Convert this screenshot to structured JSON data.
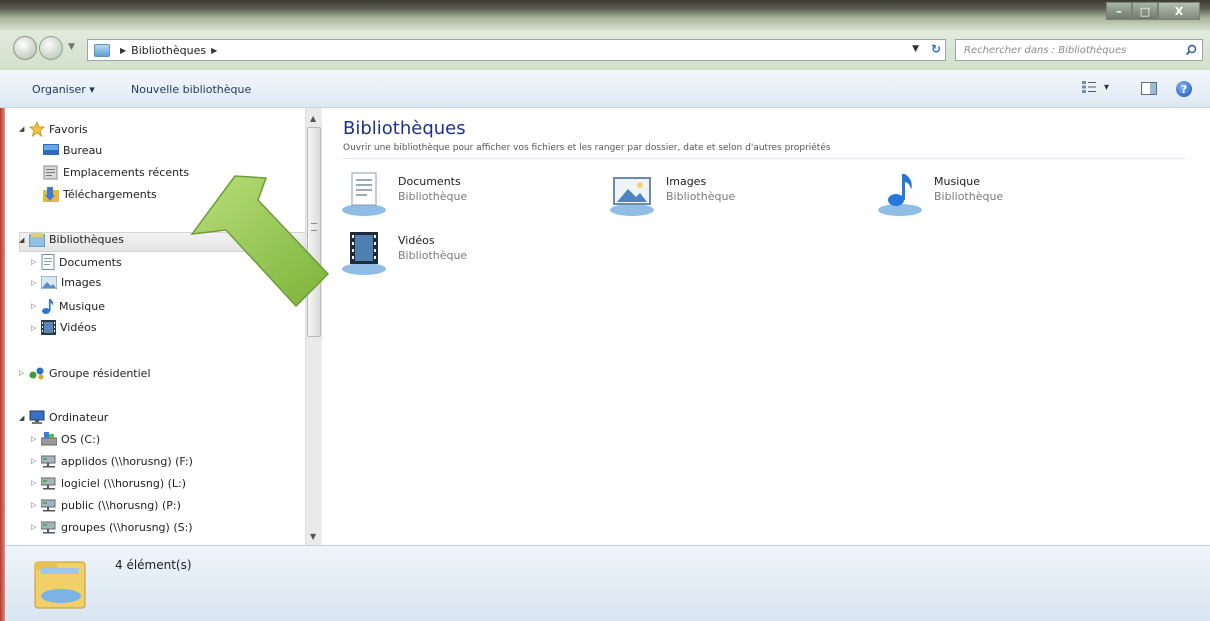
{
  "window": {
    "controls": {
      "minimize": "–",
      "maximize": "□",
      "close": "X"
    }
  },
  "address": {
    "crumbs": [
      "Bibliothèques"
    ],
    "search_placeholder": "Rechercher dans : Bibliothèques"
  },
  "toolbar": {
    "organize_label": "Organiser ▾",
    "new_library_label": "Nouvelle bibliothèque",
    "view_arrow": "▾",
    "help_label": "?"
  },
  "nav": {
    "favorites": {
      "label": "Favoris",
      "items": [
        {
          "label": "Bureau",
          "icon": "desktop-icon"
        },
        {
          "label": "Emplacements récents",
          "icon": "recent-places-icon"
        },
        {
          "label": "Téléchargements",
          "icon": "downloads-icon"
        }
      ]
    },
    "libraries": {
      "label": "Bibliothèques",
      "items": [
        {
          "label": "Documents",
          "icon": "documents-icon"
        },
        {
          "label": "Images",
          "icon": "pictures-icon"
        },
        {
          "label": "Musique",
          "icon": "music-icon"
        },
        {
          "label": "Vidéos",
          "icon": "videos-icon"
        }
      ]
    },
    "homegroup": {
      "label": "Groupe résidentiel"
    },
    "computer": {
      "label": "Ordinateur",
      "items": [
        {
          "label": "OS (C:)",
          "icon": "local-disk-icon"
        },
        {
          "label": "applidos (\\\\horusng) (F:)",
          "icon": "network-drive-icon"
        },
        {
          "label": "logiciel (\\\\horusng) (L:)",
          "icon": "network-drive-icon"
        },
        {
          "label": "public (\\\\horusng) (P:)",
          "icon": "network-drive-icon"
        },
        {
          "label": "groupes (\\\\horusng) (S:)",
          "icon": "network-drive-icon"
        }
      ]
    }
  },
  "content": {
    "title": "Bibliothèques",
    "description": "Ouvrir une bibliothèque pour afficher vos fichiers et les ranger par dossier, date et selon d'autres propriétés",
    "libraries": [
      {
        "name": "Documents",
        "type": "Bibliothèque",
        "icon": "documents-library-icon"
      },
      {
        "name": "Images",
        "type": "Bibliothèque",
        "icon": "images-library-icon"
      },
      {
        "name": "Musique",
        "type": "Bibliothèque",
        "icon": "music-library-icon"
      },
      {
        "name": "Vidéos",
        "type": "Bibliothèque",
        "icon": "videos-library-icon"
      }
    ]
  },
  "status": {
    "count_text": "4 élément(s)"
  },
  "colors": {
    "accent_title": "#1e3287",
    "annotation_arrow": "#8fc24a"
  }
}
